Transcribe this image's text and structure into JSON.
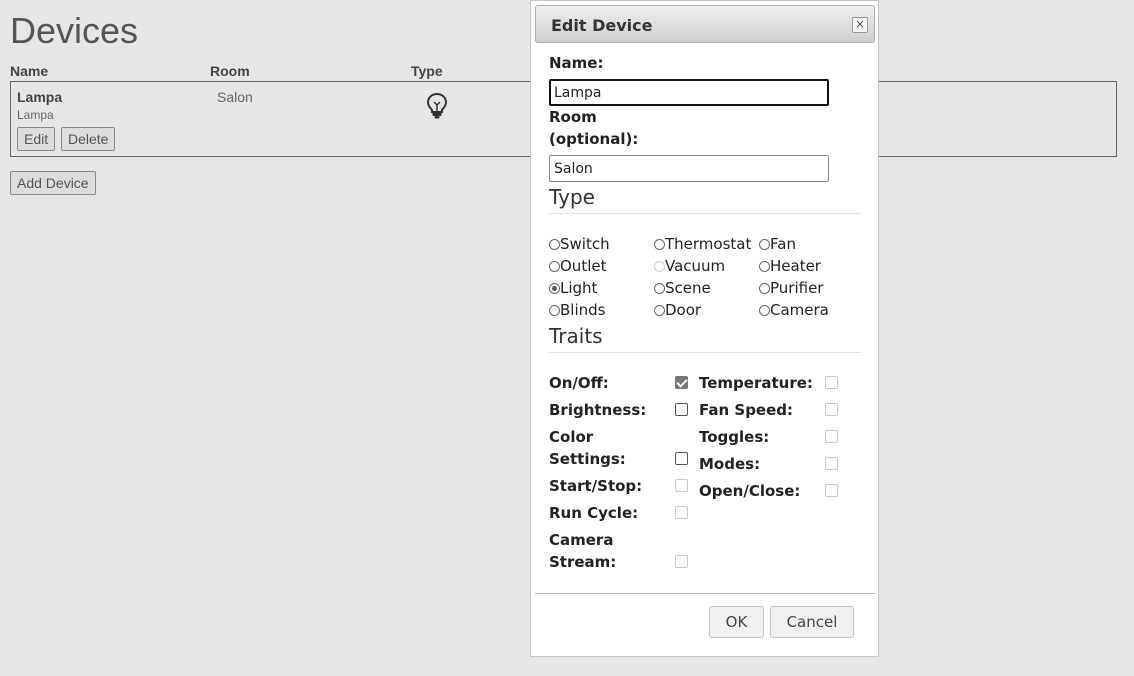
{
  "page": {
    "title": "Devices",
    "columns": {
      "name": "Name",
      "room": "Room",
      "type": "Type"
    },
    "device": {
      "name": "Lampa",
      "subname": "Lampa",
      "room": "Salon",
      "type_icon": "lightbulb-icon"
    },
    "buttons": {
      "edit": "Edit",
      "delete": "Delete",
      "add": "Add Device"
    }
  },
  "dialog": {
    "title": "Edit Device",
    "close_glyph": "×",
    "name_label": "Name:",
    "name_value": "Lampa",
    "room_label_1": "Room",
    "room_label_2": "(optional):",
    "room_value": "Salon",
    "type_heading": "Type",
    "types": [
      {
        "label": "Switch",
        "checked": false,
        "disabled": false
      },
      {
        "label": "Thermostat",
        "checked": false,
        "disabled": false
      },
      {
        "label": "Fan",
        "checked": false,
        "disabled": false
      },
      {
        "label": "Outlet",
        "checked": false,
        "disabled": false
      },
      {
        "label": "Vacuum",
        "checked": false,
        "disabled": true
      },
      {
        "label": "Heater",
        "checked": false,
        "disabled": false
      },
      {
        "label": "Light",
        "checked": true,
        "disabled": false
      },
      {
        "label": "Scene",
        "checked": false,
        "disabled": false
      },
      {
        "label": "Purifier",
        "checked": false,
        "disabled": false
      },
      {
        "label": "Blinds",
        "checked": false,
        "disabled": false
      },
      {
        "label": "Door",
        "checked": false,
        "disabled": false
      },
      {
        "label": "Camera",
        "checked": false,
        "disabled": false
      }
    ],
    "traits_heading": "Traits",
    "traits_left": [
      {
        "label": "On/Off:",
        "checked": true,
        "disabled": false
      },
      {
        "label": "Brightness:",
        "checked": false,
        "disabled": false
      },
      {
        "label": "Color\nSettings:",
        "checked": false,
        "disabled": false
      },
      {
        "label": "Start/Stop:",
        "checked": false,
        "disabled": true
      },
      {
        "label": "Run Cycle:",
        "checked": false,
        "disabled": true
      },
      {
        "label": "Camera\nStream:",
        "checked": false,
        "disabled": true
      }
    ],
    "traits_right": [
      {
        "label": "Temperature:",
        "checked": false,
        "disabled": true
      },
      {
        "label": "Fan Speed:",
        "checked": false,
        "disabled": true
      },
      {
        "label": "Toggles:",
        "checked": false,
        "disabled": true
      },
      {
        "label": "Modes:",
        "checked": false,
        "disabled": true
      },
      {
        "label": "Open/Close:",
        "checked": false,
        "disabled": true
      }
    ],
    "ok_label": "OK",
    "cancel_label": "Cancel"
  }
}
